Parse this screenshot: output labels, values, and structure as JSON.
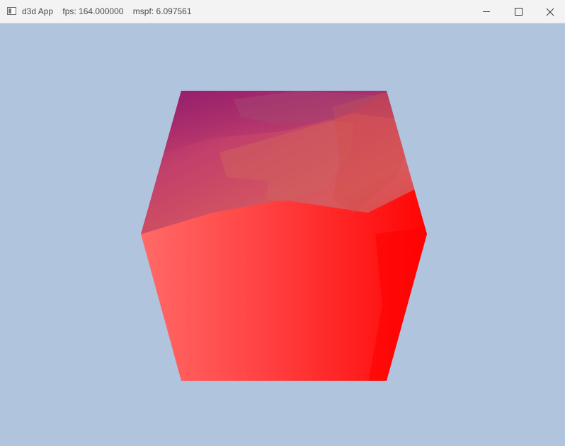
{
  "window": {
    "title": "d3d App    fps: 164.000000    mspf: 6.097561",
    "app_icon": "window-app-icon",
    "controls": {
      "minimize_icon": "minimize-icon",
      "maximize_icon": "maximize-icon",
      "close_icon": "close-icon"
    }
  },
  "viewport": {
    "background_color": "#b0c4de",
    "object": "rotating-cube",
    "colors": {
      "top_face_start": "#9b1a6a",
      "top_face_mid": "#d64a62",
      "top_face_end": "#e0403c",
      "front_left": "#ff6a68",
      "front_right": "#ff0000"
    }
  }
}
